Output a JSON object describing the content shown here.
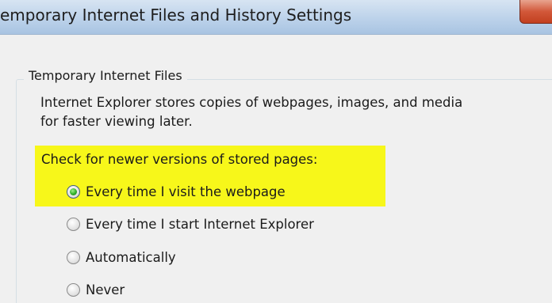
{
  "dialog": {
    "title": "emporary Internet Files and History Settings"
  },
  "group": {
    "label": "Temporary Internet Files",
    "description_line1": "Internet Explorer stores copies of webpages, images, and media",
    "description_line2": "for faster viewing later."
  },
  "check_newer": {
    "label": "Check for newer versions of stored pages:",
    "options": [
      {
        "label": "Every time I visit the webpage",
        "checked": true
      },
      {
        "label": "Every time I start Internet Explorer",
        "checked": false
      },
      {
        "label": "Automatically",
        "checked": false
      },
      {
        "label": "Never",
        "checked": false
      }
    ],
    "highlight_color": "#f7f71a",
    "selected_dot_color": "#2fae28"
  },
  "icons": {
    "close": "close-icon",
    "radio": "radio-button-icon"
  }
}
